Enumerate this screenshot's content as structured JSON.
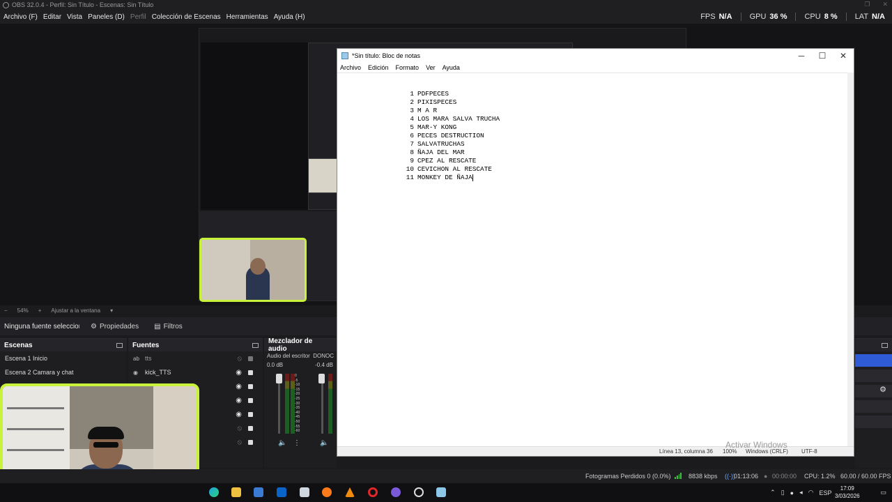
{
  "obs": {
    "window_title": "OBS 32.0.4 - Perfil: Sin Título - Escenas: Sin Título",
    "menu": [
      "Archivo (F)",
      "Editar",
      "Vista",
      "Paneles (D)",
      "Perfil",
      "Colección de Escenas",
      "Herramientas",
      "Ayuda (H)"
    ],
    "stats": {
      "fps_label": "FPS",
      "fps_value": "N/A",
      "gpu_label": "GPU",
      "gpu_value": "36 %",
      "cpu_label": "CPU",
      "cpu_value": "8 %",
      "lat_label": "LAT",
      "lat_value": "N/A"
    },
    "zoom": {
      "minus": "−",
      "value": "54%",
      "plus": "+",
      "fit": "Ajustar a la ventana"
    },
    "context_bar": {
      "no_source": "Ninguna fuente seleccionada",
      "properties": "Propiedades",
      "filters": "Filtros"
    },
    "scenes": {
      "title": "Escenas",
      "items": [
        "Escena 1 Inicio",
        "Escena 2  Camara y chat"
      ]
    },
    "sources": {
      "title": "Fuentes",
      "items": [
        {
          "icon": "ab",
          "name": "tts"
        },
        {
          "icon": "◉",
          "name": "kick_TTS"
        }
      ]
    },
    "mixer": {
      "title": "Mezclador de audio",
      "tracks": [
        {
          "name": "Audio del escritorio",
          "db": "0.0 dB"
        },
        {
          "name": "DONOC",
          "db": "-0.4 dB"
        }
      ],
      "scale": [
        "0",
        "-5",
        "-10",
        "-15",
        "-20",
        "-25",
        "-30",
        "-35",
        "-40",
        "-45",
        "-50",
        "-55",
        "-60"
      ]
    },
    "status": {
      "dropped": "Fotogramas Perdidos 0 (0.0%)",
      "bitrate": "8838 kbps",
      "stream_time": "01:13:06",
      "rec_time": "00:00:00",
      "cpu": "CPU: 1.2%",
      "fps": "60.00 / 60.00 FPS"
    }
  },
  "notepad": {
    "title": "*Sin título: Bloc de notas",
    "menu": [
      "Archivo",
      "Edición",
      "Formato",
      "Ver",
      "Ayuda"
    ],
    "lines": [
      {
        "n": "1",
        "text": "PDFPECES"
      },
      {
        "n": "2",
        "text": "PIXISPECES"
      },
      {
        "n": "3",
        "text": "M A R"
      },
      {
        "n": "4",
        "text": "LOS MARA SALVA TRUCHA"
      },
      {
        "n": "5",
        "text": "MAR-Y KONG"
      },
      {
        "n": "6",
        "text": "PECES DESTRUCTION"
      },
      {
        "n": "7",
        "text": "SALVATRUCHAS"
      },
      {
        "n": "8",
        "text": "ÑAJA DEL MAR"
      },
      {
        "n": "9",
        "text": "CPEZ AL RESCATE"
      },
      {
        "n": "10",
        "text": "CEVICHON AL RESCATE"
      },
      {
        "n": "11",
        "text": "MONKEY DE ÑAJA"
      }
    ],
    "status": {
      "position": "Línea 13, columna 36",
      "zoom": "100%",
      "eol": "Windows (CRLF)",
      "encoding": "UTF-8"
    }
  },
  "watermark": "Activar Windows",
  "taskbar": {
    "lang": "ESP",
    "time": "17:09",
    "date": "3/03/2026"
  },
  "colors": {
    "obs_bg": "#1b1b1e",
    "webcam_border": "#c9f23a",
    "meter_green": "#1f5e22",
    "notepad_bg": "#ffffff"
  }
}
